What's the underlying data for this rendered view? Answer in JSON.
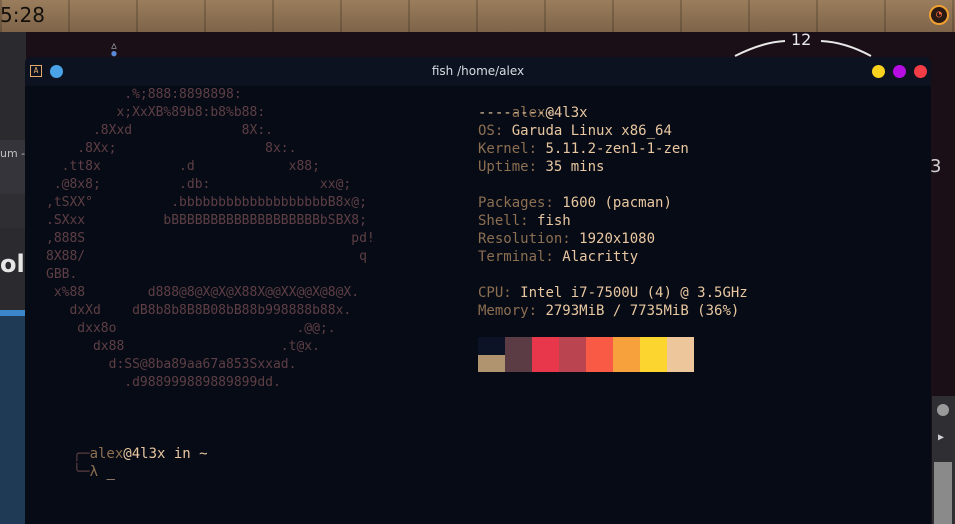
{
  "topbar": {
    "clock": "5:28",
    "tray_icon": "speedometer-icon"
  },
  "background": {
    "fragment_text": "um -",
    "fragment_big": "olo",
    "right_digit": "3"
  },
  "workspace": {
    "number": "12"
  },
  "terminal": {
    "title": "fish /home/alex",
    "title_icon": "A",
    "window_buttons": [
      {
        "name": "minimize",
        "color": "#f9d11f"
      },
      {
        "name": "maximize",
        "color": "#b60ee2"
      },
      {
        "name": "close",
        "color": "#f23d47"
      }
    ],
    "ascii_logo": [
      "          .%;888:8898898:",
      "         x;XxXB%89b8:b8%b88:",
      "      .8Xxd              8X:.",
      "    .8Xx;                   8x:.",
      "  .tt8x          .d            x88;",
      " .@8x8;          .db:              xx@;",
      ",tSXX°          .bbbbbbbbbbbbbbbbbbbB8x@;",
      ".SXxx          bBBBBBBBBBBBBBBBBBBBbSBX8;",
      ",888S                                  pd!",
      "8X88/                                   q",
      "GBB.",
      " x%88        d888@8@X@X@X88X@@XX@@X@8@X.",
      "   dxXd    dB8b8b8B8B08bB88b998888b88x.",
      "    dxx8o                       .@@;.",
      "      dx88                    .t@x.",
      "        d:SS@8ba89aa67a853Sxxad.",
      "          .d988999889889899dd."
    ],
    "sysinfo": {
      "user": "alex",
      "at": "@",
      "host": "4l3x",
      "separator": "---------",
      "rows": [
        {
          "label": "OS:",
          "value": "Garuda Linux x86_64"
        },
        {
          "label": "Kernel:",
          "value": "5.11.2-zen1-1-zen"
        },
        {
          "label": "Uptime:",
          "value": "35 mins"
        },
        {
          "label": "Packages:",
          "value": "1600 (pacman)"
        },
        {
          "label": "Shell:",
          "value": "fish"
        },
        {
          "label": "Resolution:",
          "value": "1920x1080"
        },
        {
          "label": "Terminal:",
          "value": "Alacritty"
        },
        {
          "label": "CPU:",
          "value": "Intel i7-7500U (4) @ 3.5GHz"
        },
        {
          "label": "Memory:",
          "value": "2793MiB / 7735MiB (36%)"
        }
      ],
      "colors_top": [
        "#0c1326",
        "#5b3b44",
        "#e8364a",
        "#bb4451",
        "#f85a45",
        "#f6a13b",
        "#fcd52e",
        "#edc69c"
      ],
      "colors_bottom": [
        "#b09470",
        "#5b3b44",
        "#e8364a",
        "#bb4451",
        "#f85a45",
        "#f6a13b",
        "#fcd52e",
        "#edc69c"
      ]
    },
    "prompt": {
      "corner_top": "╭─",
      "user": "alex",
      "at": "@",
      "host": "4l3x",
      "in": " in ",
      "dir": "~",
      "corner_bottom": "╰─",
      "symbol": "λ",
      "cursor": "_"
    }
  }
}
